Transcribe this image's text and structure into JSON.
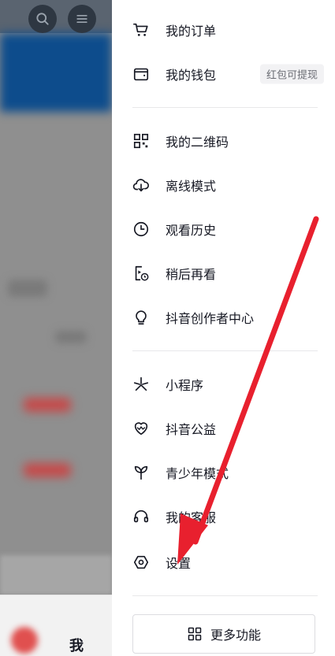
{
  "background": {
    "tab_me_label": "我"
  },
  "drawer": {
    "items_group1": [
      {
        "label": "我的订单",
        "icon": "cart-icon"
      },
      {
        "label": "我的钱包",
        "icon": "wallet-icon",
        "badge": "红包可提现"
      }
    ],
    "items_group2": [
      {
        "label": "我的二维码",
        "icon": "qrcode-icon"
      },
      {
        "label": "离线模式",
        "icon": "cloud-download-icon"
      },
      {
        "label": "观看历史",
        "icon": "clock-icon"
      },
      {
        "label": "稍后再看",
        "icon": "watch-later-icon"
      },
      {
        "label": "抖音创作者中心",
        "icon": "lightbulb-icon"
      }
    ],
    "items_group3": [
      {
        "label": "小程序",
        "icon": "mini-program-icon"
      },
      {
        "label": "抖音公益",
        "icon": "charity-heart-icon"
      },
      {
        "label": "青少年模式",
        "icon": "sprout-icon"
      },
      {
        "label": "我的客服",
        "icon": "headset-icon"
      },
      {
        "label": "设置",
        "icon": "settings-hexagon-icon"
      }
    ],
    "more_button_label": "更多功能"
  },
  "colors": {
    "text": "#161823",
    "badge_bg": "#f2f2f4",
    "arrow": "#e8202e"
  }
}
